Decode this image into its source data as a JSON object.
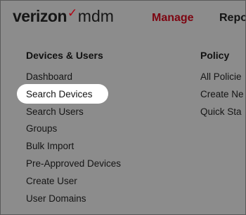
{
  "header": {
    "brand_name": "verizon",
    "brand_check": "✓",
    "brand_product": "mdm",
    "nav": [
      {
        "label": "Manage",
        "active": true
      },
      {
        "label": "Repo",
        "active": false
      }
    ]
  },
  "menu": {
    "columns": [
      {
        "heading": "Devices & Users",
        "items": [
          {
            "label": "Dashboard"
          },
          {
            "label": "Search Devices",
            "highlighted": true
          },
          {
            "label": "Search Users"
          },
          {
            "label": "Groups"
          },
          {
            "label": "Bulk Import"
          },
          {
            "label": "Pre-Approved Devices"
          },
          {
            "label": "Create User"
          },
          {
            "label": "User Domains"
          }
        ]
      },
      {
        "heading": "Policy",
        "items": [
          {
            "label": "All Policie"
          },
          {
            "label": "Create Ne"
          },
          {
            "label": "Quick Sta"
          }
        ]
      }
    ]
  },
  "colors": {
    "overlay": "#8c8c8c",
    "brand_red": "#b00012",
    "active_nav": "#7d0511",
    "highlight": "#ffffff"
  }
}
